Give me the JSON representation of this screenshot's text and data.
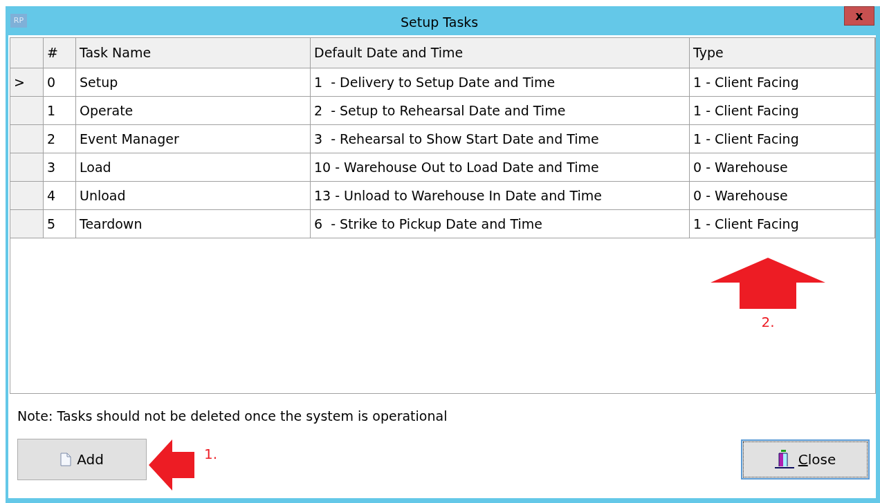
{
  "window": {
    "title": "Setup Tasks",
    "app_badge": "RP",
    "close_glyph": "x"
  },
  "table": {
    "columns": [
      "#",
      "Task Name",
      "Default Date and Time",
      "Type"
    ],
    "current_marker": ">",
    "rows": [
      {
        "selected": true,
        "cells": [
          "0",
          "Setup",
          "1  - Delivery to Setup Date and Time",
          "1 - Client Facing"
        ]
      },
      {
        "selected": false,
        "cells": [
          "1",
          "Operate",
          "2  - Setup to Rehearsal Date and Time",
          "1 - Client Facing"
        ]
      },
      {
        "selected": false,
        "cells": [
          "2",
          "Event Manager",
          "3  - Rehearsal to Show Start Date and Time",
          "1 - Client Facing"
        ]
      },
      {
        "selected": false,
        "cells": [
          "3",
          "Load",
          "10 - Warehouse Out to Load Date and Time",
          "0 - Warehouse"
        ]
      },
      {
        "selected": false,
        "cells": [
          "4",
          "Unload",
          "13 - Unload to Warehouse In Date and Time",
          "0 - Warehouse"
        ]
      },
      {
        "selected": false,
        "cells": [
          "5",
          "Teardown",
          "6  - Strike to Pickup Date and Time",
          "1 - Client Facing"
        ]
      }
    ]
  },
  "note": "Note: Tasks should not be deleted once the system is operational",
  "buttons": [
    {
      "label": "Add",
      "kind": "add"
    },
    {
      "label": "Close",
      "kind": "close"
    }
  ],
  "annotations": [
    {
      "label": "1.",
      "kind": "left"
    },
    {
      "label": "2.",
      "kind": "up"
    }
  ]
}
